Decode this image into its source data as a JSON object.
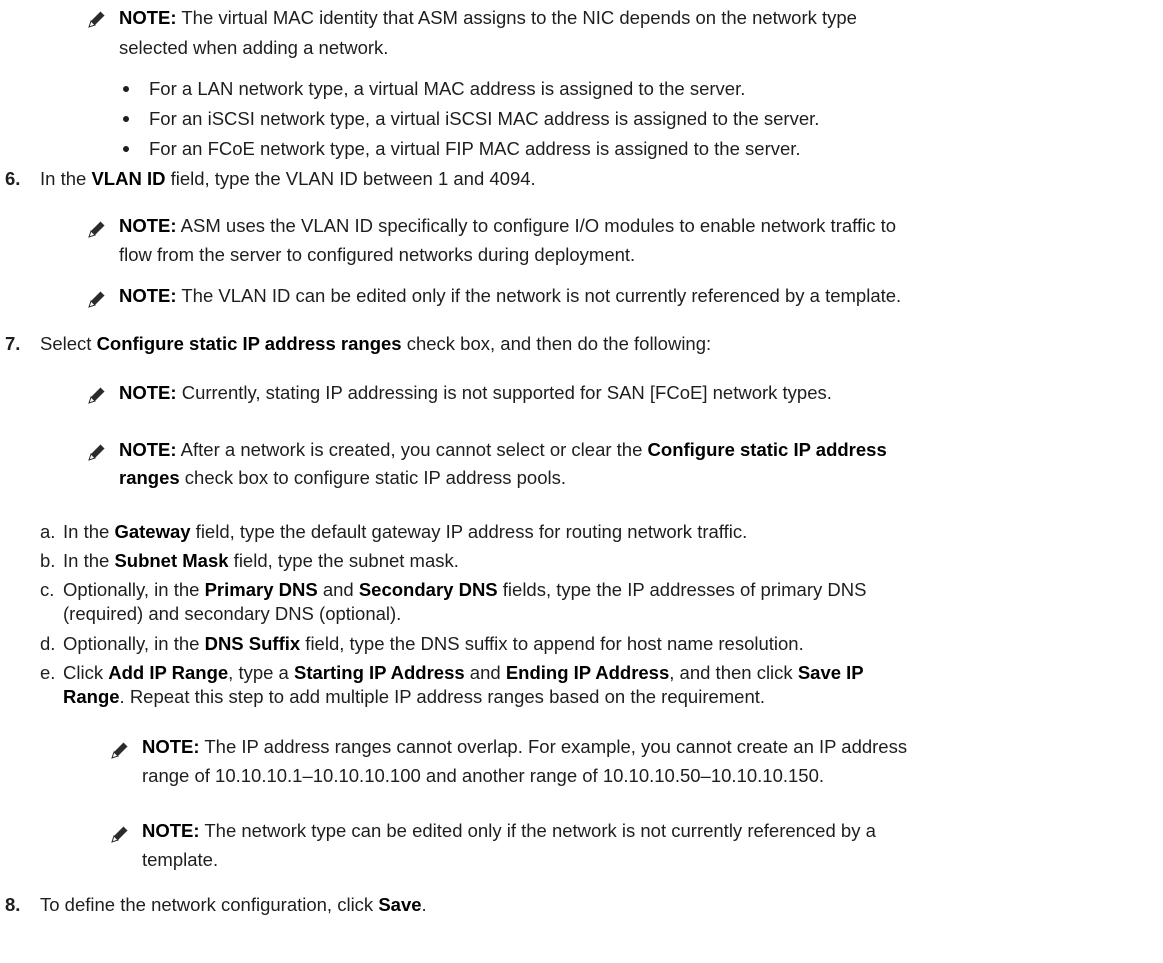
{
  "note_label": "NOTE:",
  "note1": {
    "line1": " The virtual MAC identity that ASM assigns to the NIC depends on the network type",
    "line2": "selected when adding a network.",
    "bullets": [
      "For a LAN network type, a virtual MAC address is assigned to the server.",
      "For an iSCSI network type, a virtual iSCSI MAC address is assigned to the server.",
      "For an FCoE network type, a virtual FIP MAC address is assigned to the server."
    ]
  },
  "step6": {
    "num": "6.",
    "t1": "In the ",
    "b1": "VLAN ID",
    "t2": " field, type the VLAN ID between 1 and 4094.",
    "note_a_line1": " ASM uses the VLAN ID specifically to configure I/O modules to enable network traffic to",
    "note_a_line2": "flow from the server to configured networks during deployment.",
    "note_b": " The VLAN ID can be edited only if the network is not currently referenced by a template."
  },
  "step7": {
    "num": "7.",
    "t1": "Select ",
    "b1": "Configure static IP address ranges",
    "t2": " check box, and then do the following:",
    "note_a": " Currently, stating IP addressing is not supported for SAN [FCoE] network types.",
    "note_b_t1": " After a network is created, you cannot select or clear the ",
    "note_b_b1": "Configure static IP address",
    "note_b_b2": "ranges",
    "note_b_t2": " check box to configure static IP address pools.",
    "a": {
      "label": "a.",
      "t1": "In the ",
      "b1": "Gateway",
      "t2": " field, type the default gateway IP address for routing network traffic."
    },
    "b": {
      "label": "b.",
      "t1": "In the ",
      "b1": "Subnet Mask",
      "t2": " field, type the subnet mask."
    },
    "c": {
      "label": "c.",
      "t1": "Optionally, in the ",
      "b1": "Primary DNS",
      "t2": " and ",
      "b2": "Secondary DNS",
      "t3": " fields, type the IP addresses of primary DNS",
      "line2": "(required) and secondary DNS (optional)."
    },
    "d": {
      "label": "d.",
      "t1": "Optionally, in the ",
      "b1": "DNS Suffix",
      "t2": " field, type the DNS suffix to append for host name resolution."
    },
    "e": {
      "label": "e.",
      "t1": "Click ",
      "b1": "Add IP Range",
      "t2": ", type a ",
      "b2": "Starting IP Address",
      "t3": " and ",
      "b3": "Ending IP Address",
      "t4": ", and then click ",
      "b4": "Save IP",
      "b5": "Range",
      "t5": ". Repeat this step to add multiple IP address ranges based on the requirement."
    },
    "note_c_line1": " The IP address ranges cannot overlap. For example, you cannot create an IP address",
    "note_c_line2": "range of 10.10.10.1–10.10.10.100 and another range of 10.10.10.50–10.10.10.150.",
    "note_d_line1": " The network type can be edited only if the network is not currently referenced by a",
    "note_d_line2": "template."
  },
  "step8": {
    "num": "8.",
    "t1": "To define the network configuration, click ",
    "b1": "Save",
    "t2": "."
  }
}
